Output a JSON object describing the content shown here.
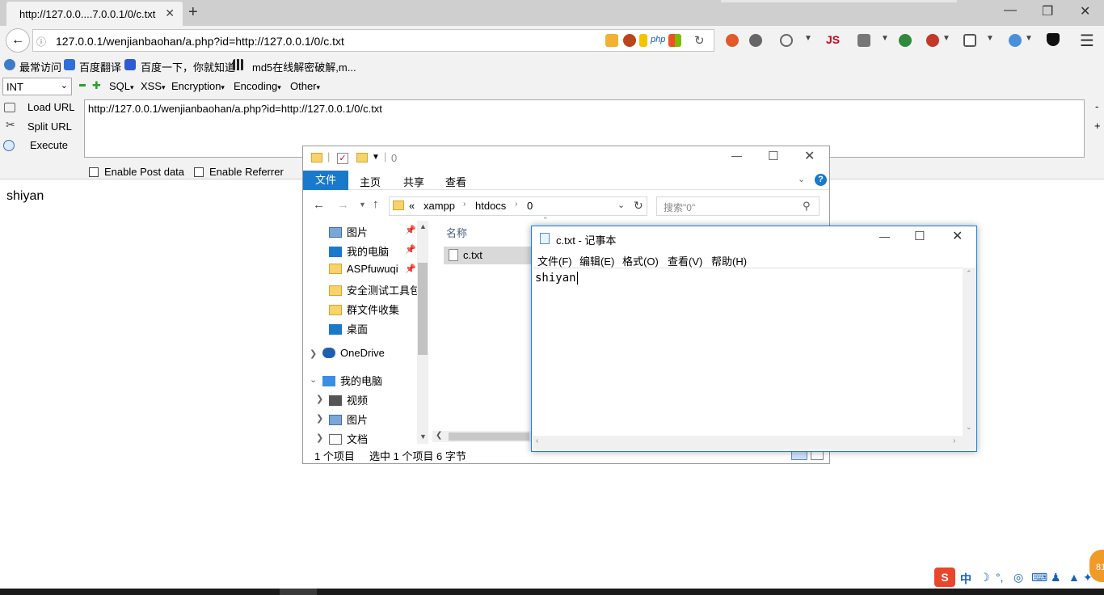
{
  "browser": {
    "tab_title": "http://127.0.0....7.0.0.1/0/c.txt",
    "tab_close": "✕",
    "new_tab": "+",
    "address": "127.0.0.1/wenjianbaohan/a.php?id=http://127.0.0.1/0/c.txt",
    "info_glyph": "ⓘ",
    "php_badge": "php",
    "js_badge": "JS",
    "window_controls": {
      "minimize": "—",
      "restore": "❐",
      "close": "✕"
    }
  },
  "bookmarks": [
    {
      "label": "最常访问",
      "icon": "gear-icon"
    },
    {
      "label": "百度翻译",
      "icon": "translate-icon"
    },
    {
      "label": "百度一下，你就知道",
      "icon": "baidu-paw-icon"
    },
    {
      "label": "md5在线解密破解,m...",
      "icon": "grid-icon"
    }
  ],
  "hackbar": {
    "select_value": "INT",
    "menus": [
      "SQL",
      "XSS",
      "Encryption",
      "Encoding",
      "Other"
    ],
    "side_buttons": [
      "Load URL",
      "Split URL",
      "Execute"
    ],
    "url_value": "http://127.0.0.1/wenjianbaohan/a.php?id=http://127.0.0.1/0/c.txt",
    "checkboxes": [
      "Enable Post data",
      "Enable Referrer"
    ],
    "minus": "-",
    "plus": "+"
  },
  "page": {
    "content": "shiyan"
  },
  "explorer": {
    "title": "0",
    "ribbon_tabs": [
      "文件",
      "主页",
      "共享",
      "查看"
    ],
    "breadcrumb": [
      "«",
      "xampp",
      "htdocs",
      "0"
    ],
    "search_placeholder": "搜索\"0\"",
    "column_header": "名称",
    "files": [
      "c.txt"
    ],
    "nav_quick": [
      {
        "label": "图片",
        "pinned": true,
        "icon": "pictures-icon"
      },
      {
        "label": "我的电脑",
        "pinned": true,
        "icon": "computer-icon"
      },
      {
        "label": "ASPfuwuqi",
        "pinned": true,
        "icon": "folder-icon"
      },
      {
        "label": "安全测试工具包",
        "pinned": false,
        "icon": "folder-icon"
      },
      {
        "label": "群文件收集",
        "pinned": false,
        "icon": "folder-icon"
      },
      {
        "label": "桌面",
        "pinned": false,
        "icon": "desktop-icon"
      }
    ],
    "nav_onedrive": "OneDrive",
    "nav_thispc": "我的电脑",
    "nav_pc_children": [
      {
        "label": "视频",
        "icon": "video-icon"
      },
      {
        "label": "图片",
        "icon": "pictures-icon"
      },
      {
        "label": "文档",
        "icon": "documents-icon"
      }
    ],
    "status": {
      "count": "1 个项目",
      "selected": "选中 1 个项目",
      "size": "6 字节"
    }
  },
  "notepad": {
    "title": "c.txt - 记事本",
    "menu": [
      "文件(F)",
      "编辑(E)",
      "格式(O)",
      "查看(V)",
      "帮助(H)"
    ],
    "content": "shiyan"
  },
  "tray": {
    "ime": "中",
    "badge": "81"
  },
  "colors": {
    "accent": "#1979ca",
    "notepad_border": "#1883d7",
    "js_red": "#d0021b"
  }
}
